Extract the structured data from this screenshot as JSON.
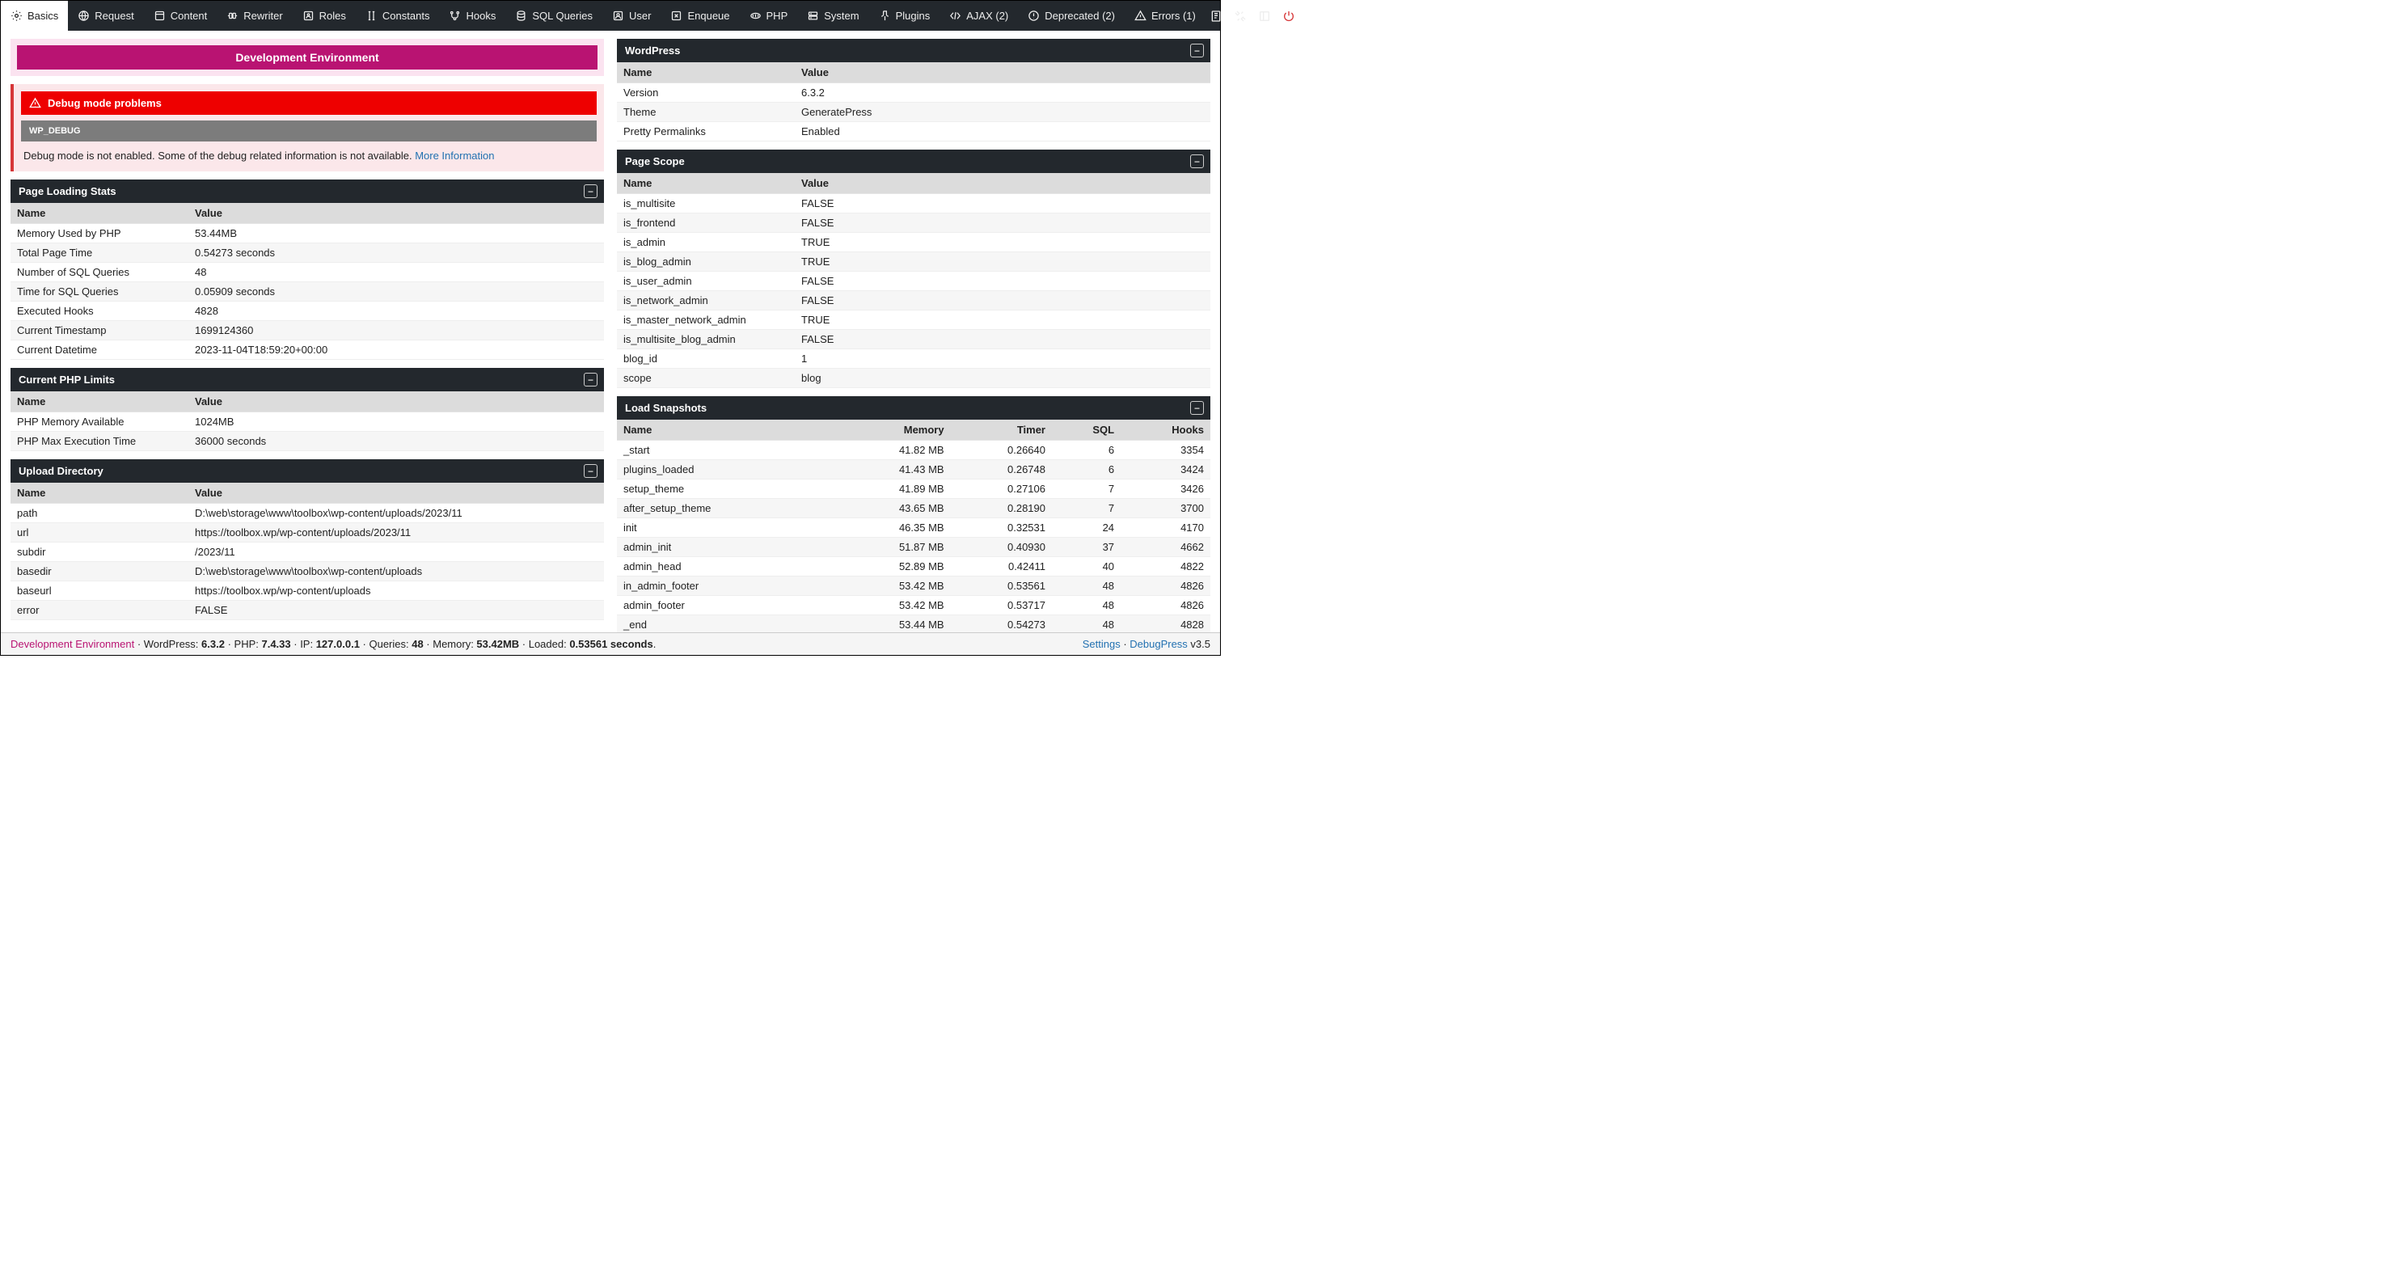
{
  "tabs": [
    {
      "label": "Basics",
      "active": true
    },
    {
      "label": "Request"
    },
    {
      "label": "Content"
    },
    {
      "label": "Rewriter"
    },
    {
      "label": "Roles"
    },
    {
      "label": "Constants"
    },
    {
      "label": "Hooks"
    },
    {
      "label": "SQL Queries"
    },
    {
      "label": "User"
    },
    {
      "label": "Enqueue"
    },
    {
      "label": "PHP"
    },
    {
      "label": "System"
    },
    {
      "label": "Plugins"
    },
    {
      "label": "AJAX (2)"
    },
    {
      "label": "Deprecated (2)"
    },
    {
      "label": "Errors (1)"
    }
  ],
  "env_banner": "Development Environment",
  "debug": {
    "title": "Debug mode problems",
    "tag": "WP_DEBUG",
    "msg": "Debug mode is not enabled. Some of the debug related information is not available. ",
    "link": "More Information"
  },
  "headers": {
    "name": "Name",
    "value": "Value",
    "memory": "Memory",
    "timer": "Timer",
    "sql": "SQL",
    "hooks": "Hooks"
  },
  "panels": {
    "page_loading": {
      "title": "Page Loading Stats",
      "rows": [
        {
          "k": "Memory Used by PHP",
          "v": "53.44MB"
        },
        {
          "k": "Total Page Time",
          "v": "0.54273 seconds"
        },
        {
          "k": "Number of SQL Queries",
          "v": "48"
        },
        {
          "k": "Time for SQL Queries",
          "v": "0.05909 seconds"
        },
        {
          "k": "Executed Hooks",
          "v": "4828"
        },
        {
          "k": "Current Timestamp",
          "v": "1699124360"
        },
        {
          "k": "Current Datetime",
          "v": "2023-11-04T18:59:20+00:00"
        }
      ]
    },
    "php_limits": {
      "title": "Current PHP Limits",
      "rows": [
        {
          "k": "PHP Memory Available",
          "v": "1024MB"
        },
        {
          "k": "PHP Max Execution Time",
          "v": "36000 seconds"
        }
      ]
    },
    "upload_dir": {
      "title": "Upload Directory",
      "rows": [
        {
          "k": "path",
          "v": "D:\\web\\storage\\www\\toolbox\\wp-content/uploads/2023/11"
        },
        {
          "k": "url",
          "v": "https://toolbox.wp/wp-content/uploads/2023/11"
        },
        {
          "k": "subdir",
          "v": "/2023/11"
        },
        {
          "k": "basedir",
          "v": "D:\\web\\storage\\www\\toolbox\\wp-content/uploads"
        },
        {
          "k": "baseurl",
          "v": "https://toolbox.wp/wp-content/uploads"
        },
        {
          "k": "error",
          "v": "FALSE"
        }
      ]
    },
    "wordpress": {
      "title": "WordPress",
      "rows": [
        {
          "k": "Version",
          "v": "6.3.2"
        },
        {
          "k": "Theme",
          "v": "GeneratePress"
        },
        {
          "k": "Pretty Permalinks",
          "v": "Enabled"
        }
      ]
    },
    "page_scope": {
      "title": "Page Scope",
      "rows": [
        {
          "k": "is_multisite",
          "v": "FALSE"
        },
        {
          "k": "is_frontend",
          "v": "FALSE"
        },
        {
          "k": "is_admin",
          "v": "TRUE"
        },
        {
          "k": "is_blog_admin",
          "v": "TRUE"
        },
        {
          "k": "is_user_admin",
          "v": "FALSE"
        },
        {
          "k": "is_network_admin",
          "v": "FALSE"
        },
        {
          "k": "is_master_network_admin",
          "v": "TRUE"
        },
        {
          "k": "is_multisite_blog_admin",
          "v": "FALSE"
        },
        {
          "k": "blog_id",
          "v": "1"
        },
        {
          "k": "scope",
          "v": "blog"
        }
      ]
    },
    "snapshots": {
      "title": "Load Snapshots",
      "rows": [
        {
          "n": "_start",
          "m": "41.82 MB",
          "t": "0.26640",
          "s": "6",
          "h": "3354"
        },
        {
          "n": "plugins_loaded",
          "m": "41.43 MB",
          "t": "0.26748",
          "s": "6",
          "h": "3424"
        },
        {
          "n": "setup_theme",
          "m": "41.89 MB",
          "t": "0.27106",
          "s": "7",
          "h": "3426"
        },
        {
          "n": "after_setup_theme",
          "m": "43.65 MB",
          "t": "0.28190",
          "s": "7",
          "h": "3700"
        },
        {
          "n": "init",
          "m": "46.35 MB",
          "t": "0.32531",
          "s": "24",
          "h": "4170"
        },
        {
          "n": "admin_init",
          "m": "51.87 MB",
          "t": "0.40930",
          "s": "37",
          "h": "4662"
        },
        {
          "n": "admin_head",
          "m": "52.89 MB",
          "t": "0.42411",
          "s": "40",
          "h": "4822"
        },
        {
          "n": "in_admin_footer",
          "m": "53.42 MB",
          "t": "0.53561",
          "s": "48",
          "h": "4826"
        },
        {
          "n": "admin_footer",
          "m": "53.42 MB",
          "t": "0.53717",
          "s": "48",
          "h": "4826"
        },
        {
          "n": "_end",
          "m": "53.44 MB",
          "t": "0.54273",
          "s": "48",
          "h": "4828"
        }
      ]
    }
  },
  "footer": {
    "env": "Development Environment",
    "wp_label": " · WordPress: ",
    "wp": "6.3.2",
    "php_label": " · PHP: ",
    "php": "7.4.33",
    "ip_label": " · IP: ",
    "ip": "127.0.0.1",
    "q_label": " · Queries: ",
    "q": "48",
    "mem_label": " · Memory: ",
    "mem": "53.42MB",
    "load_label": " · Loaded: ",
    "load": "0.53561 seconds",
    "dot": ".",
    "settings": "Settings",
    "sep": " · ",
    "brand": "DebugPress",
    "ver": " v3.5"
  }
}
